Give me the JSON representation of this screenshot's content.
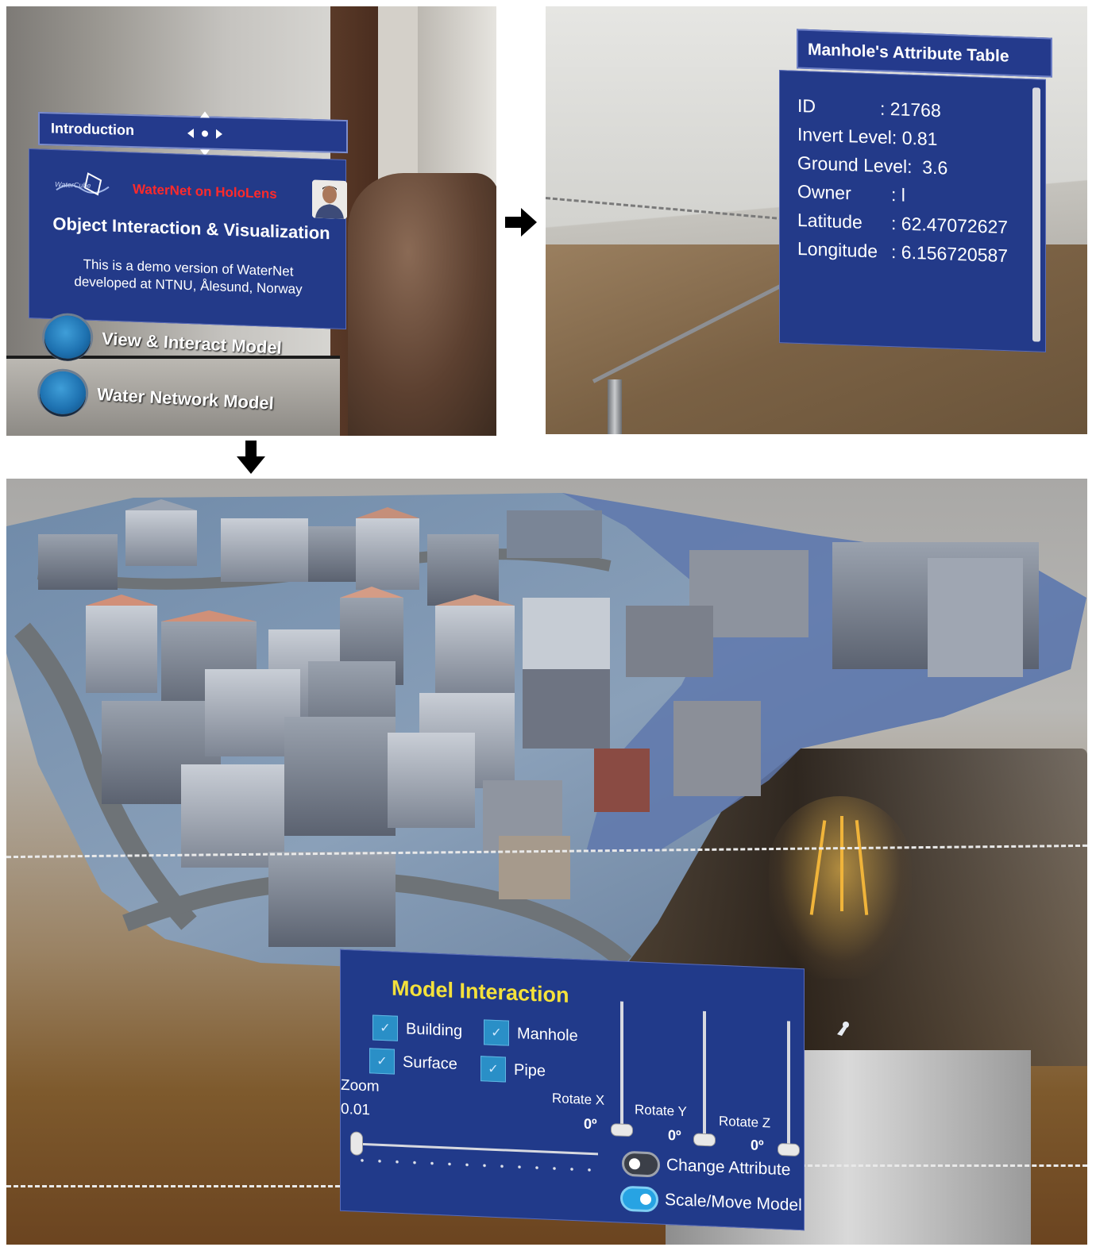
{
  "intro_panel": {
    "bar_title": "Introduction",
    "brand_logo_text": "WaterCube",
    "brand_name": "WaterNet on HoloLens",
    "heading": "Object Interaction & Visualization",
    "body_line1": "This is a demo version of WaterNet",
    "body_line2": "developed at NTNU, Ålesund, Norway",
    "buttons": [
      {
        "label": "View & Interact Model"
      },
      {
        "label": "Water Network Model"
      }
    ]
  },
  "attribute_panel": {
    "title": "Manhole's Attribute Table",
    "rows": [
      {
        "key": "ID",
        "value": ": 21768"
      },
      {
        "key": "Invert Level:",
        "value": "0.81"
      },
      {
        "key": "Ground Level:",
        "value": "3.6"
      },
      {
        "key": "Owner",
        "value": ": l"
      },
      {
        "key": "Latitude",
        "value": ": 62.47072627"
      },
      {
        "key": "Longitude",
        "value": ": 6.156720587"
      }
    ]
  },
  "model_panel": {
    "title": "Model Interaction",
    "checkboxes": [
      {
        "label": "Building",
        "checked": true
      },
      {
        "label": "Manhole",
        "checked": true
      },
      {
        "label": "Surface",
        "checked": true
      },
      {
        "label": "Pipe",
        "checked": true
      }
    ],
    "zoom": {
      "label": "Zoom",
      "value": "0.01"
    },
    "rotations": [
      {
        "label": "Rotate X",
        "value": "0º"
      },
      {
        "label": "Rotate Y",
        "value": "0º"
      },
      {
        "label": "Rotate Z",
        "value": "0º"
      }
    ],
    "toggles": [
      {
        "label": "Change Attribute",
        "on": false
      },
      {
        "label": "Scale/Move Model",
        "on": true
      }
    ]
  },
  "colors": {
    "panel_blue": "#233a89",
    "title_yellow": "#f4e13b",
    "brand_red": "#ff2a2a",
    "toggle_on": "#27a3e3"
  },
  "icons": [
    "move-arrows-icon",
    "check-icon",
    "arrow-right-icon",
    "arrow-down-icon",
    "hand-cursor-icon"
  ]
}
